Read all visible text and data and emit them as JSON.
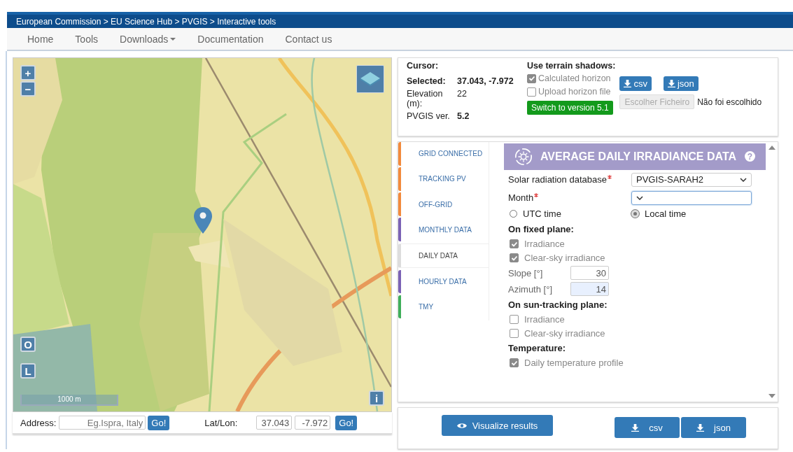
{
  "breadcrumb": "European Commission > EU Science Hub > PVGIS > Interactive tools",
  "nav": [
    {
      "label": "Home",
      "dropdown": false
    },
    {
      "label": "Tools",
      "dropdown": false
    },
    {
      "label": "Downloads",
      "dropdown": true
    },
    {
      "label": "Documentation",
      "dropdown": false
    },
    {
      "label": "Contact us",
      "dropdown": false
    }
  ],
  "map": {
    "zoom_in": "+",
    "zoom_out": "−",
    "view_buttons": [
      "O",
      "L"
    ],
    "info": "i",
    "scale": "1000 m"
  },
  "location_bar": {
    "address_label": "Address:",
    "address_placeholder": "Eg.Ispra, Italy",
    "address_go": "Go!",
    "latlon_label": "Lat/Lon:",
    "lat": "37.043",
    "lon": "-7.972",
    "latlon_go": "Go!"
  },
  "cursor_info": {
    "cursor_label": "Cursor:",
    "selected_label": "Selected:",
    "selected_value": "37.043, -7.972",
    "elevation_label": "Elevation (m):",
    "elevation_value": "22",
    "version_label": "PVGIS ver.",
    "version_value": "5.2"
  },
  "terrain": {
    "title": "Use terrain shadows:",
    "options": [
      {
        "label": "Calculated horizon",
        "checked": true
      },
      {
        "label": "Upload horizon file",
        "checked": false
      }
    ],
    "switch_button": "Switch to version 5.1"
  },
  "horizon_downloads": [
    "csv",
    "json"
  ],
  "file_input": {
    "button": "Escolher Ficheiro",
    "status": "Não foi escolhido"
  },
  "tabs": [
    {
      "label": "GRID CONNECTED",
      "color": "#f28a3c",
      "selected": false
    },
    {
      "label": "TRACKING PV",
      "color": "#f28a3c",
      "selected": false
    },
    {
      "label": "OFF-GRID",
      "color": "#f28a3c",
      "selected": false
    },
    {
      "label": "MONTHLY DATA",
      "color": "#7b62b5",
      "selected": false
    },
    {
      "label": "DAILY DATA",
      "color": "#dddddd",
      "selected": true
    },
    {
      "label": "HOURLY DATA",
      "color": "#7b62b5",
      "selected": false
    },
    {
      "label": "TMY",
      "color": "#3fae5a",
      "selected": false
    }
  ],
  "section": {
    "title": "AVERAGE DAILY IRRADIANCE DATA",
    "help": "?"
  },
  "form": [
    {
      "kind": "select",
      "label": "Solar radiation database",
      "required": true,
      "value": "PVGIS-SARAH2"
    },
    {
      "kind": "select",
      "label": "Month",
      "required": true,
      "focused": true
    },
    {
      "kind": "radios",
      "options": [
        {
          "label": "UTC time",
          "selected": false
        },
        {
          "label": "Local time",
          "selected": true
        }
      ]
    },
    {
      "kind": "heading",
      "label": "On fixed plane:"
    },
    {
      "kind": "checkbox",
      "label": "Irradiance",
      "checked": true
    },
    {
      "kind": "checkbox",
      "label": "Clear-sky irradiance",
      "checked": true
    },
    {
      "kind": "number",
      "label": "Slope [°]",
      "value": "30",
      "highlighted": false
    },
    {
      "kind": "number",
      "label": "Azimuth [°]",
      "value": "14",
      "highlighted": true
    },
    {
      "kind": "heading",
      "label": "On sun-tracking plane:"
    },
    {
      "kind": "checkbox",
      "label": "Irradiance",
      "checked": false
    },
    {
      "kind": "checkbox",
      "label": "Clear-sky irradiance",
      "checked": false
    },
    {
      "kind": "heading",
      "label": "Temperature:"
    },
    {
      "kind": "checkbox",
      "label": "Daily temperature profile",
      "checked": true
    }
  ],
  "visualize_button": "Visualize results",
  "result_downloads": [
    "csv",
    "json"
  ]
}
